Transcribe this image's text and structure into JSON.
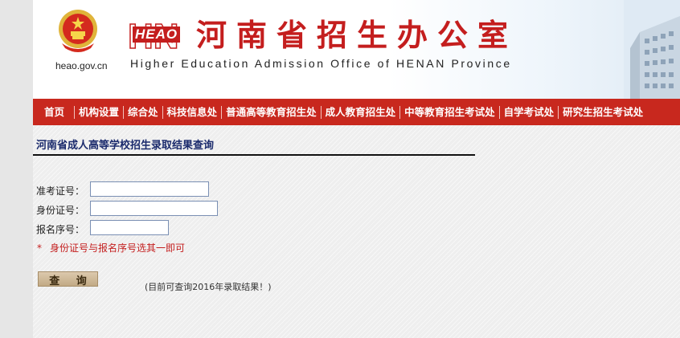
{
  "header": {
    "domain": "heao.gov.cn",
    "logo_text": "HEAO",
    "title_cn": "河南省招生办公室",
    "title_en": "Higher Education Admission Office of HENAN Province"
  },
  "nav": {
    "items": [
      {
        "label": "首页"
      },
      {
        "label": "机构设置"
      },
      {
        "label": "综合处"
      },
      {
        "label": "科技信息处"
      },
      {
        "label": "普通高等教育招生处"
      },
      {
        "label": "成人教育招生处"
      },
      {
        "label": "中等教育招生考试处"
      },
      {
        "label": "自学考试处"
      },
      {
        "label": "研究生招生考试处"
      }
    ]
  },
  "main": {
    "title": "河南省成人高等学校招生录取结果查询",
    "form": {
      "exam_no_label": "准考证号：",
      "exam_no_value": "",
      "id_no_label": "身份证号：",
      "id_no_value": "",
      "reg_no_label": "报名序号：",
      "reg_no_value": "",
      "note_star": "*",
      "note_text": "身份证号与报名序号选其一即可"
    },
    "query_button": "查 询",
    "hint": "(目前可查询2016年录取结果！)"
  },
  "colors": {
    "brand_red": "#c8281e",
    "title_red": "#c41e1e",
    "section_title_blue": "#1a2a6c",
    "button_tan": "#c2aa85"
  },
  "icons": {
    "emblem": "national-emblem-icon",
    "building": "office-building-image"
  }
}
